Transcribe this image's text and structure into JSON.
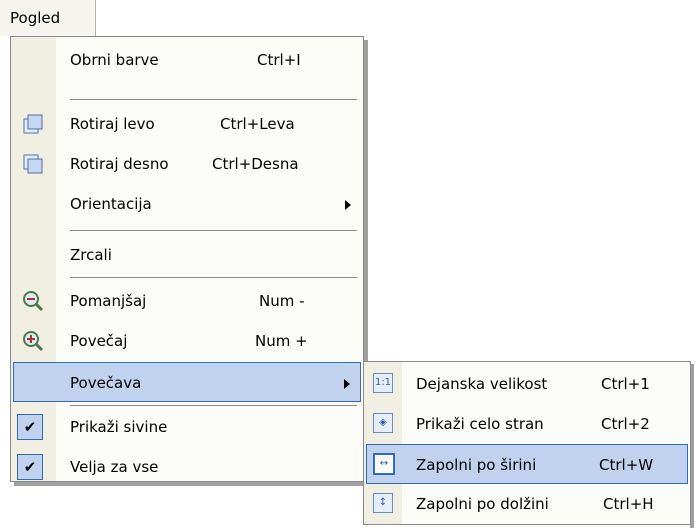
{
  "menubar": {
    "title": "Pogled"
  },
  "menu": {
    "items": [
      {
        "label": "Obrni barve",
        "shortcut": "Ctrl+I"
      },
      {
        "label": "Rotiraj levo",
        "shortcut": "Ctrl+Leva"
      },
      {
        "label": "Rotiraj desno",
        "shortcut": "Ctrl+Desna"
      },
      {
        "label": "Orientacija",
        "shortcut": ""
      },
      {
        "label": "Zrcali",
        "shortcut": ""
      },
      {
        "label": "Pomanjšaj",
        "shortcut": "Num -"
      },
      {
        "label": "Povečaj",
        "shortcut": "Num +"
      },
      {
        "label": "Povečava",
        "shortcut": ""
      },
      {
        "label": "Prikaži sivine",
        "shortcut": ""
      },
      {
        "label": "Velja za vse",
        "shortcut": ""
      }
    ],
    "checked": [
      "Prikaži sivine",
      "Velja za vse"
    ],
    "highlighted": "Povečava"
  },
  "submenu": {
    "items": [
      {
        "label": "Dejanska velikost",
        "shortcut": "Ctrl+1",
        "icon": "1:1"
      },
      {
        "label": "Prikaži celo stran",
        "shortcut": "Ctrl+2",
        "icon": "fit-page-icon"
      },
      {
        "label": "Zapolni po širini",
        "shortcut": "Ctrl+W",
        "icon": "fit-width-icon"
      },
      {
        "label": "Zapolni po dolžini",
        "shortcut": "Ctrl+H",
        "icon": "fit-height-icon"
      }
    ],
    "highlighted": "Zapolni po širini"
  },
  "colors": {
    "highlight": "#c1d2ee",
    "highlight_border": "#316ac5",
    "gutter": "#f1efe2"
  }
}
